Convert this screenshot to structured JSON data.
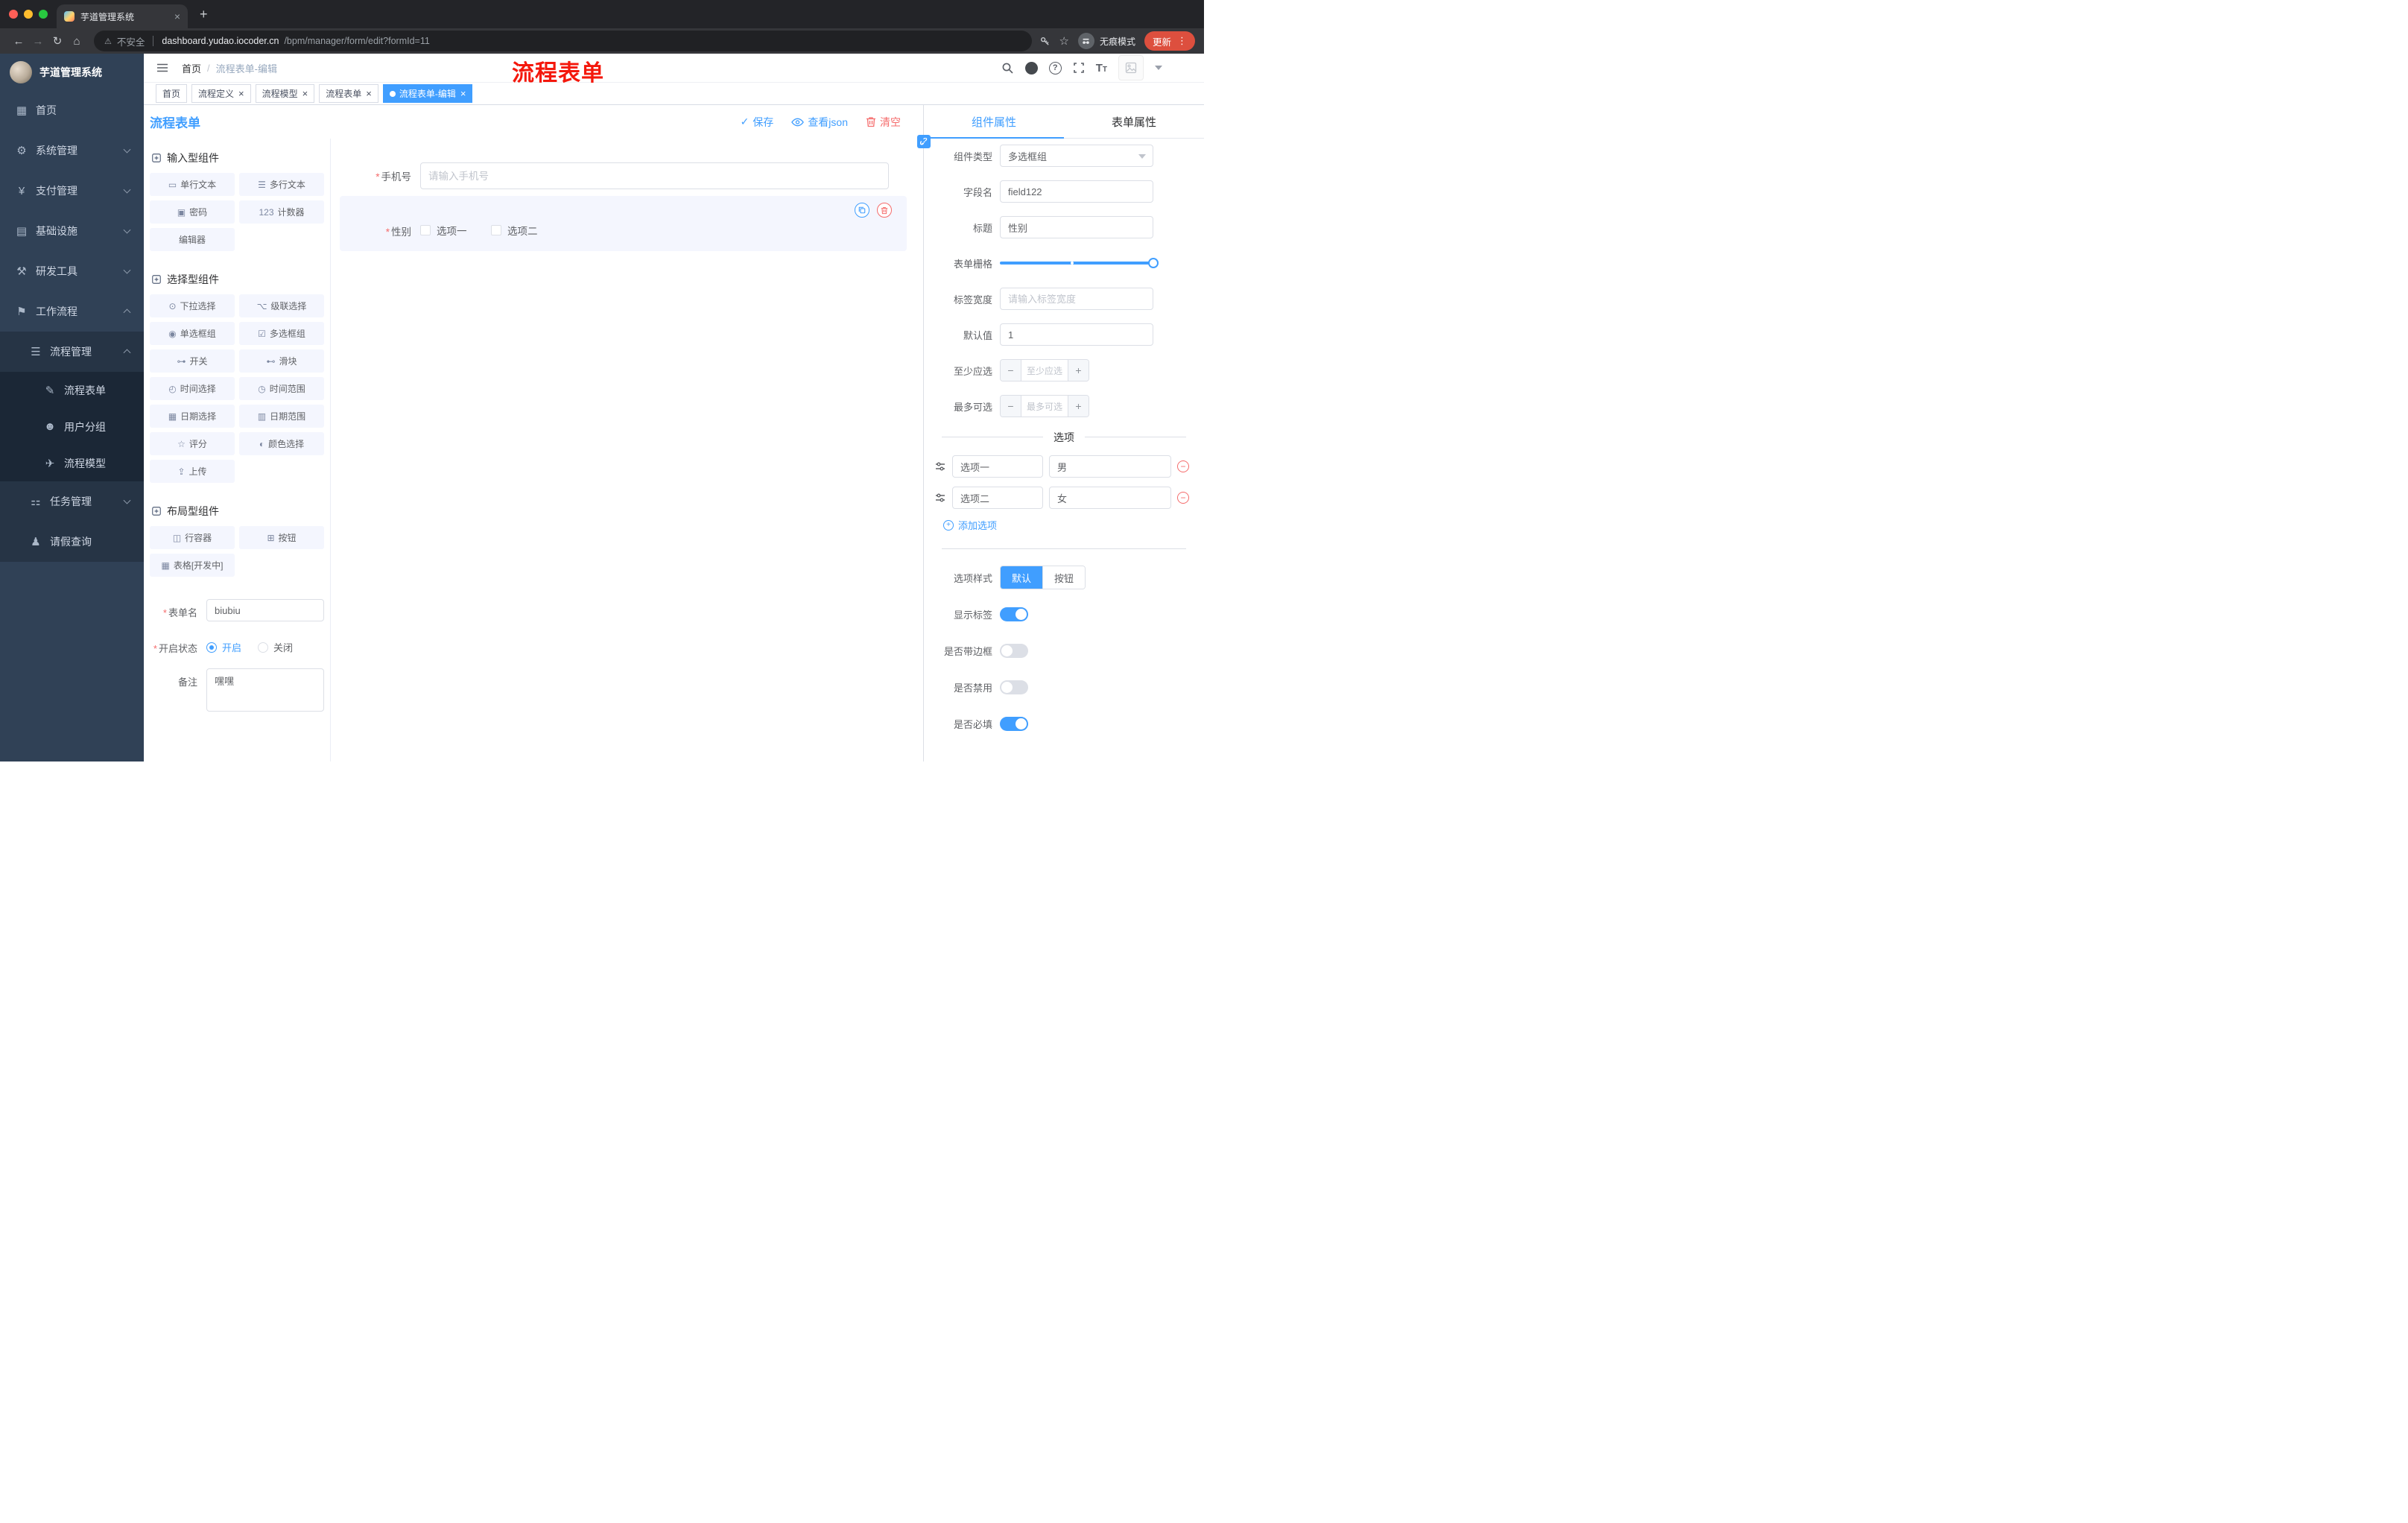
{
  "browser": {
    "tab_title": "芋道管理系统",
    "security_label": "不安全",
    "url_host": "dashboard.yudao.iocoder.cn",
    "url_path": "/bpm/manager/form/edit?formId=11",
    "incognito_label": "无痕模式",
    "update_label": "更新"
  },
  "icons": {
    "close": "×",
    "new_tab": "+",
    "back": "←",
    "forward": "→",
    "reload": "↻",
    "home": "⌂",
    "warning": "⚠",
    "star": "☆",
    "dots": "⋮",
    "check": "✓",
    "asterisk": "*",
    "minus": "−",
    "plus": "+",
    "question": "?"
  },
  "sidebar": {
    "logo_title": "芋道管理系统",
    "items": [
      {
        "label": "首页",
        "glyph": "▦",
        "level": 0
      },
      {
        "label": "系统管理",
        "glyph": "⚙",
        "level": 0,
        "chevron": "down"
      },
      {
        "label": "支付管理",
        "glyph": "¥",
        "level": 0,
        "chevron": "down"
      },
      {
        "label": "基础设施",
        "glyph": "▤",
        "level": 0,
        "chevron": "down"
      },
      {
        "label": "研发工具",
        "glyph": "⚒",
        "level": 0,
        "chevron": "down"
      },
      {
        "label": "工作流程",
        "glyph": "⚑",
        "level": 0,
        "chevron": "up"
      },
      {
        "label": "流程管理",
        "glyph": "☰",
        "level": 1,
        "chevron": "up"
      },
      {
        "label": "流程表单",
        "glyph": "✎",
        "level": 2
      },
      {
        "label": "用户分组",
        "glyph": "☻",
        "level": 2
      },
      {
        "label": "流程模型",
        "glyph": "✈",
        "level": 2
      },
      {
        "label": "任务管理",
        "glyph": "⚏",
        "level": 1,
        "chevron": "down"
      },
      {
        "label": "请假查询",
        "glyph": "♟",
        "level": 1
      }
    ]
  },
  "header": {
    "breadcrumb_home": "首页",
    "breadcrumb_sep": "/",
    "breadcrumb_current": "流程表单-编辑",
    "watermark": "流程表单",
    "font_size_icon_text": "T"
  },
  "tags": [
    {
      "label": "首页"
    },
    {
      "label": "流程定义",
      "closable": true
    },
    {
      "label": "流程模型",
      "closable": true
    },
    {
      "label": "流程表单",
      "closable": true
    },
    {
      "label": "流程表单-编辑",
      "closable": true,
      "active": true
    }
  ],
  "toolbar": {
    "title": "流程表单",
    "save_label": "保存",
    "view_json_label": "查看json",
    "clear_label": "清空"
  },
  "palette": {
    "sections": [
      {
        "title": "输入型组件",
        "items": [
          {
            "label": "单行文本",
            "glyph": "▭"
          },
          {
            "label": "多行文本",
            "glyph": "☰"
          },
          {
            "label": "密码",
            "glyph": "▣"
          },
          {
            "label": "计数器",
            "glyph": "123"
          },
          {
            "label": "编辑器",
            "glyph": ""
          }
        ]
      },
      {
        "title": "选择型组件",
        "items": [
          {
            "label": "下拉选择",
            "glyph": "⊙"
          },
          {
            "label": "级联选择",
            "glyph": "⌥"
          },
          {
            "label": "单选框组",
            "glyph": "◉"
          },
          {
            "label": "多选框组",
            "glyph": "☑"
          },
          {
            "label": "开关",
            "glyph": "⊶"
          },
          {
            "label": "滑块",
            "glyph": "⊷"
          },
          {
            "label": "时间选择",
            "glyph": "◴"
          },
          {
            "label": "时间范围",
            "glyph": "◷"
          },
          {
            "label": "日期选择",
            "glyph": "▦"
          },
          {
            "label": "日期范围",
            "glyph": "▥"
          },
          {
            "label": "评分",
            "glyph": "☆"
          },
          {
            "label": "颜色选择",
            "glyph": "◐"
          },
          {
            "label": "上传",
            "glyph": "⇪"
          }
        ]
      },
      {
        "title": "布局型组件",
        "items": [
          {
            "label": "行容器",
            "glyph": "◫"
          },
          {
            "label": "按钮",
            "glyph": "⊞"
          },
          {
            "label": "表格[开发中]",
            "glyph": "▦"
          }
        ]
      }
    ],
    "form": {
      "name_label": "表单名",
      "name_value": "biubiu",
      "status_label": "开启状态",
      "status_on": "开启",
      "status_off": "关闭",
      "remark_label": "备注",
      "remark_value": "嘿嘿"
    }
  },
  "canvas": {
    "phone_label": "手机号",
    "phone_placeholder": "请输入手机号",
    "gender_label": "性别",
    "gender_options": [
      {
        "label": "选项一"
      },
      {
        "label": "选项二"
      }
    ]
  },
  "inspector": {
    "tabs": [
      {
        "label": "组件属性",
        "active": true
      },
      {
        "label": "表单属性"
      }
    ],
    "rows": {
      "type_label": "组件类型",
      "type_value": "多选框组",
      "field_label": "字段名",
      "field_value": "field122",
      "title_label": "标题",
      "title_value": "性别",
      "grid_label": "表单栅格",
      "label_width_label": "标签宽度",
      "label_width_placeholder": "请输入标签宽度",
      "default_label": "默认值",
      "default_value": "1",
      "min_label": "至少应选",
      "min_placeholder": "至少应选",
      "max_label": "最多可选",
      "max_placeholder": "最多可选"
    },
    "options_divider": "选项",
    "options": [
      {
        "label": "选项一",
        "value": "男"
      },
      {
        "label": "选项二",
        "value": "女"
      }
    ],
    "add_option_label": "添加选项",
    "style_label": "选项样式",
    "style_options": [
      {
        "label": "默认",
        "active": true
      },
      {
        "label": "按钮"
      }
    ],
    "switches": [
      {
        "label": "显示标签",
        "on": true
      },
      {
        "label": "是否带边框",
        "on": false
      },
      {
        "label": "是否禁用",
        "on": false
      },
      {
        "label": "是否必填",
        "on": true
      }
    ]
  },
  "colors": {
    "accent": "#409eff",
    "danger": "#f56c6c",
    "watermark": "#f4180c"
  }
}
